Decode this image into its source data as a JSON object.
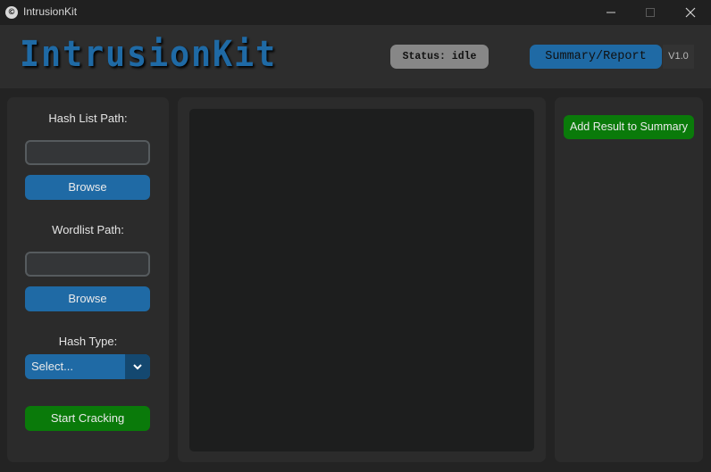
{
  "window": {
    "title": "IntrusionKit",
    "icon": "app-logo-icon",
    "controls": [
      "minimize-icon",
      "maximize-icon",
      "close-icon"
    ]
  },
  "header": {
    "logo_text": "IntrusionKit",
    "status": "Status: idle",
    "summary_label": "Summary/Report",
    "version": "V1.0"
  },
  "left_panel": {
    "hash_list_label": "Hash List Path:",
    "hash_list_value": "",
    "browse_label_1": "Browse",
    "wordlist_label": "Wordlist Path:",
    "wordlist_value": "",
    "browse_label_2": "Browse",
    "hash_type_label": "Hash Type:",
    "hash_type_selected": "Select...",
    "start_label": "Start Cracking"
  },
  "center_panel": {
    "output_text": ""
  },
  "right_panel": {
    "add_result_label": "Add Result to Summary"
  },
  "colors": {
    "accent_blue": "#1f6aa5",
    "success_green": "#0a7a0a",
    "status_grey": "#878787",
    "background": "#232323",
    "panel": "#2b2b2b"
  }
}
